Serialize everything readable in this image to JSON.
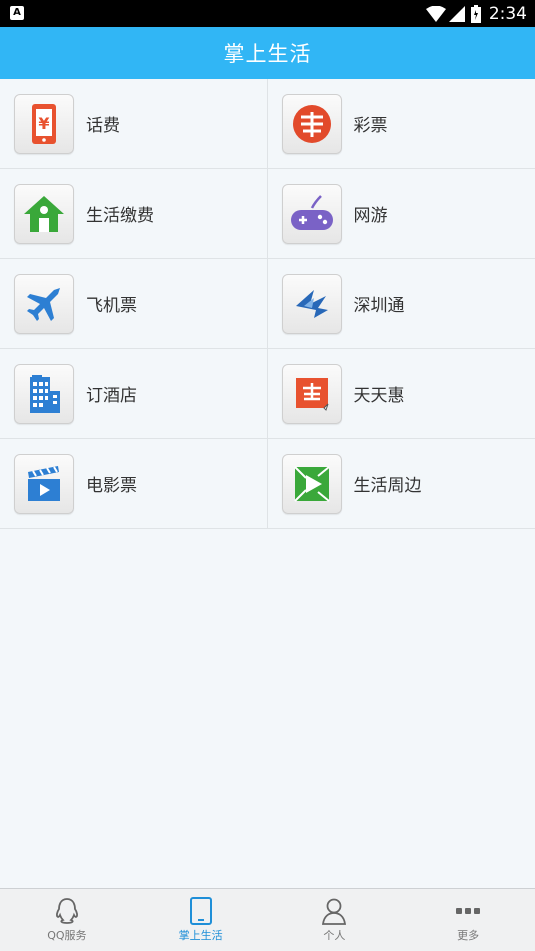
{
  "status_bar": {
    "time": "2:34"
  },
  "header": {
    "title": "掌上生活"
  },
  "grid": {
    "rows": [
      [
        {
          "label": "话费",
          "icon": "phone-bill-icon"
        },
        {
          "label": "彩票",
          "icon": "lottery-icon"
        }
      ],
      [
        {
          "label": "生活缴费",
          "icon": "home-bill-icon"
        },
        {
          "label": "网游",
          "icon": "gamepad-icon"
        }
      ],
      [
        {
          "label": "飞机票",
          "icon": "airplane-icon"
        },
        {
          "label": "深圳通",
          "icon": "shenzhen-tong-icon"
        }
      ],
      [
        {
          "label": "订酒店",
          "icon": "hotel-icon"
        },
        {
          "label": "天天惠",
          "icon": "discount-icon"
        }
      ],
      [
        {
          "label": "电影票",
          "icon": "movie-icon"
        },
        {
          "label": "生活周边",
          "icon": "nearby-icon"
        }
      ]
    ]
  },
  "tabbar": {
    "tabs": [
      {
        "label": "QQ服务",
        "icon": "qq-icon"
      },
      {
        "label": "掌上生活",
        "icon": "tablet-icon",
        "active": true
      },
      {
        "label": "个人",
        "icon": "person-icon"
      },
      {
        "label": "更多",
        "icon": "more-icon"
      }
    ]
  },
  "colors": {
    "header": "#31b6f5",
    "active_tab": "#1f8fd8"
  }
}
